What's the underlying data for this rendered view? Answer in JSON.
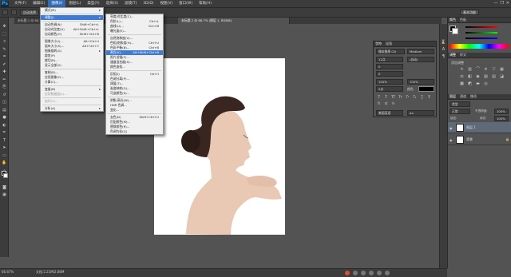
{
  "app": {
    "logo": "Ps"
  },
  "menubar": {
    "items": [
      "文件(F)",
      "编辑(E)",
      "图像(I)",
      "图层(L)",
      "类型(Y)",
      "选择(S)",
      "滤镜(T)",
      "3D(D)",
      "视图(V)",
      "窗口(W)",
      "帮助(H)"
    ],
    "active_index": 2
  },
  "window_controls": [
    "—",
    "❐",
    "✕"
  ],
  "options": {
    "button_label": "自动选择",
    "workspace": "基本功能"
  },
  "tabs": [
    "未标题-1 @ 66.7% (图层 1, RGB/8)",
    "效果.psd @ 100%",
    "未标题-2 @ 66.7% (图层 1, RGB/8)"
  ],
  "image_menu": {
    "items": [
      {
        "label": "模式(M)",
        "submenu": true
      },
      {
        "sep": true
      },
      {
        "label": "调整(J)",
        "submenu": true,
        "active": true
      },
      {
        "sep": true
      },
      {
        "label": "自动色调(N)",
        "shortcut": "Shift+Ctrl+L"
      },
      {
        "label": "自动对比度(U)",
        "shortcut": "Alt+Shift+Ctrl+L"
      },
      {
        "label": "自动颜色(O)",
        "shortcut": "Shift+Ctrl+B"
      },
      {
        "sep": true
      },
      {
        "label": "图像大小(I)...",
        "shortcut": "Alt+Ctrl+I"
      },
      {
        "label": "画布大小(S)...",
        "shortcut": "Alt+Ctrl+C"
      },
      {
        "label": "图像旋转(G)",
        "submenu": true
      },
      {
        "label": "裁剪(P)"
      },
      {
        "label": "裁切(R)..."
      },
      {
        "label": "显示全部(V)"
      },
      {
        "sep": true
      },
      {
        "label": "复制(D)..."
      },
      {
        "label": "应用图像(Y)..."
      },
      {
        "label": "计算(C)..."
      },
      {
        "sep": true
      },
      {
        "label": "变量(B)",
        "submenu": true
      },
      {
        "label": "应用数据组(L)...",
        "disabled": true
      },
      {
        "sep": true
      },
      {
        "label": "陷印(T)...",
        "disabled": true
      },
      {
        "sep": true
      },
      {
        "label": "分析(A)",
        "submenu": true
      }
    ]
  },
  "adjust_menu": {
    "items": [
      {
        "label": "亮度/对比度(C)..."
      },
      {
        "label": "色阶(L)...",
        "shortcut": "Ctrl+L"
      },
      {
        "label": "曲线(U)...",
        "shortcut": "Ctrl+M"
      },
      {
        "label": "曝光度(E)..."
      },
      {
        "sep": true
      },
      {
        "label": "自然饱和度(V)..."
      },
      {
        "label": "色相/饱和度(H)...",
        "shortcut": "Ctrl+U"
      },
      {
        "label": "色彩平衡(B)...",
        "shortcut": "Ctrl+B"
      },
      {
        "label": "黑白(K)...",
        "shortcut": "Alt+Shift+Ctrl+B",
        "highlight": true
      },
      {
        "label": "照片滤镜(F)..."
      },
      {
        "label": "通道混合器(X)..."
      },
      {
        "label": "颜色查找..."
      },
      {
        "sep": true
      },
      {
        "label": "反相(I)",
        "shortcut": "Ctrl+I"
      },
      {
        "label": "色调分离(P)..."
      },
      {
        "label": "阈值(T)..."
      },
      {
        "label": "渐变映射(G)..."
      },
      {
        "label": "可选颜色(S)..."
      },
      {
        "sep": true
      },
      {
        "label": "阴影/高光(W)..."
      },
      {
        "label": "HDR 色调..."
      },
      {
        "label": "变化..."
      },
      {
        "sep": true
      },
      {
        "label": "去色(D)",
        "shortcut": "Shift+Ctrl+U"
      },
      {
        "label": "匹配颜色(M)..."
      },
      {
        "label": "替换颜色(R)..."
      },
      {
        "label": "色调均化(Q)"
      }
    ]
  },
  "character": {
    "tabs": [
      "字符",
      "段落"
    ],
    "font": "微软雅黑 CN",
    "style": "Medium",
    "size": "12点",
    "leading": "(自动)",
    "tracking": "0",
    "vscale": "100%",
    "hscale": "100%",
    "baseline": "0点",
    "color_label": "颜色:",
    "language": "美国英语",
    "aa": "aa"
  },
  "panels": {
    "color_tabs": [
      "颜色",
      "色板"
    ],
    "adj_tabs": [
      "调整",
      "样式"
    ],
    "adj_title": "添加调整",
    "layers_tabs": [
      "图层",
      "通道",
      "路径"
    ],
    "kind": "类型",
    "blend": "正常",
    "opacity_label": "不透明度:",
    "opacity": "100%",
    "lock_label": "锁定:",
    "fill_label": "填充:",
    "fill": "100%"
  },
  "layers": [
    {
      "name": "图层 1",
      "selected": true
    },
    {
      "name": "背景",
      "selected": false
    }
  ],
  "status": {
    "zoom": "66.67%",
    "docsize": "文档:2.21M/2.86M"
  },
  "colors": {
    "menu_hl": "#3e7bd6",
    "panel": "#535353",
    "dark": "#3c3c3c"
  }
}
